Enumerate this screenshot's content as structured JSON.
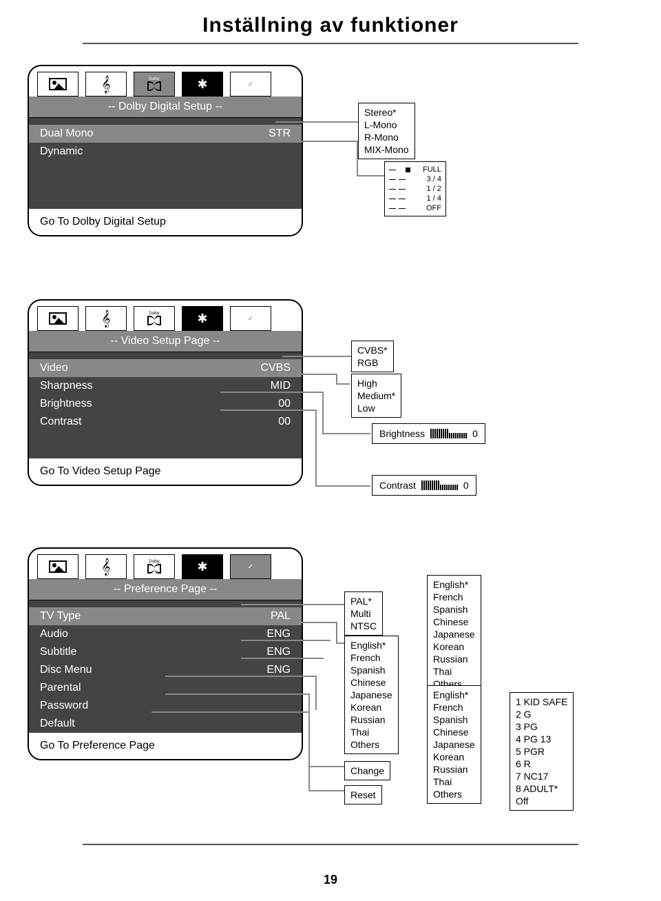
{
  "page_title": "Inställning av funktioner",
  "page_number": "19",
  "dolby_section": {
    "header": "-- Dolby Digital Setup --",
    "rows": [
      {
        "label": "Dual Mono",
        "value": "STR"
      },
      {
        "label": "Dynamic",
        "value": ""
      }
    ],
    "footer": "Go To Dolby Digital Setup",
    "dual_mono_options": [
      "Stereo*",
      "L-Mono",
      "R-Mono",
      "MIX-Mono"
    ],
    "dynamic_scale": [
      "FULL",
      "3 / 4",
      "1 / 2",
      "1 / 4",
      "OFF"
    ]
  },
  "video_section": {
    "header": "-- Video Setup Page --",
    "rows": [
      {
        "label": "Video",
        "value": "CVBS"
      },
      {
        "label": "Sharpness",
        "value": "MID"
      },
      {
        "label": "Brightness",
        "value": "00"
      },
      {
        "label": "Contrast",
        "value": "00"
      }
    ],
    "footer": "Go To Video Setup Page",
    "video_options": [
      "CVBS*",
      "RGB"
    ],
    "sharpness_options": [
      "High",
      "Medium*",
      "Low"
    ],
    "brightness_slider": {
      "label": "Brightness",
      "value": "0"
    },
    "contrast_slider": {
      "label": "Contrast",
      "value": "0"
    }
  },
  "preference_section": {
    "header": "-- Preference Page --",
    "rows": [
      {
        "label": "TV Type",
        "value": "PAL"
      },
      {
        "label": "Audio",
        "value": "ENG"
      },
      {
        "label": "Subtitle",
        "value": "ENG"
      },
      {
        "label": "Disc Menu",
        "value": "ENG"
      },
      {
        "label": "Parental",
        "value": ""
      },
      {
        "label": "Password",
        "value": ""
      },
      {
        "label": "Default",
        "value": ""
      }
    ],
    "footer": "Go To Preference Page",
    "tvtype_options": [
      "PAL*",
      "Multi",
      "NTSC"
    ],
    "lang_options_1": [
      "English*",
      "French",
      "Spanish",
      "Chinese",
      "Japanese",
      "Korean",
      "Russian",
      "Thai",
      "Others"
    ],
    "lang_options_2": [
      "English*",
      "French",
      "Spanish",
      "Chinese",
      "Japanese",
      "Korean",
      "Russian",
      "Thai",
      "Others"
    ],
    "lang_options_3": [
      "English*",
      "French",
      "Spanish",
      "Chinese",
      "Japanese",
      "Korean",
      "Russian",
      "Thai",
      "Others"
    ],
    "parental_options": [
      "1  KID SAFE",
      "2  G",
      "3  PG",
      "4  PG 13",
      "5  PGR",
      "6  R",
      "7  NC17",
      "8  ADULT*",
      "Off"
    ],
    "password_option": "Change",
    "default_option": "Reset"
  }
}
